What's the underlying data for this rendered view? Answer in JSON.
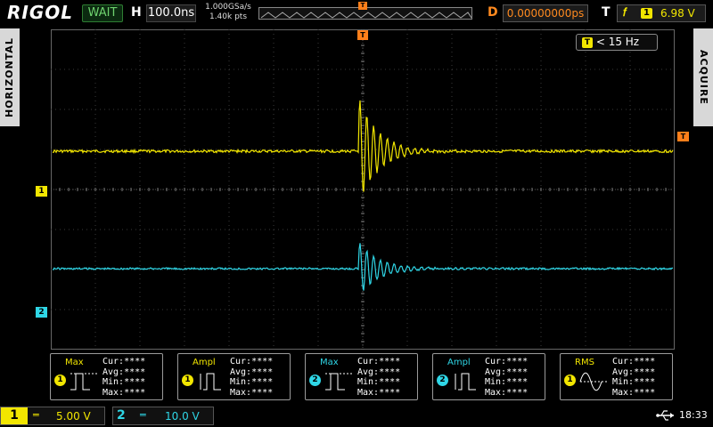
{
  "topbar": {
    "brand": "RIGOL",
    "run_status": "WAIT",
    "h_label": "H",
    "timebase": "100.0ns",
    "sample_rate": "1.000GSa/s",
    "memory_depth": "1.40k pts",
    "d_label": "D",
    "delay": "0.00000000ps",
    "t_label": "T",
    "trigger_source": "1",
    "trigger_level": "6.98 V",
    "trigger_marker": "T"
  },
  "side_tabs": {
    "left": "HORIZONTAL",
    "right": "ACQUIRE"
  },
  "frequency_counter": {
    "badge": "T",
    "value": "< 15 Hz"
  },
  "channel_markers": {
    "ch1": "1",
    "ch2": "2",
    "trigger": "T"
  },
  "colors": {
    "ch1": "#f2e600",
    "ch2": "#2fd6e6",
    "trigger": "#ff7f1a",
    "grid": "#3a3a3a",
    "status_green": "#6fd36f"
  },
  "measurements": [
    {
      "name": "Max",
      "channel": "1",
      "cur": "Cur:****",
      "avg": "Avg:****",
      "min": "Min:****",
      "max": "Max:****"
    },
    {
      "name": "Ampl",
      "channel": "1",
      "cur": "Cur:****",
      "avg": "Avg:****",
      "min": "Min:****",
      "max": "Max:****"
    },
    {
      "name": "Max",
      "channel": "2",
      "cur": "Cur:****",
      "avg": "Avg:****",
      "min": "Min:****",
      "max": "Max:****"
    },
    {
      "name": "Ampl",
      "channel": "2",
      "cur": "Cur:****",
      "avg": "Avg:****",
      "min": "Min:****",
      "max": "Max:****"
    },
    {
      "name": "RMS",
      "channel": "1",
      "cur": "Cur:****",
      "avg": "Avg:****",
      "min": "Min:****",
      "max": "Max:****"
    }
  ],
  "bottombar": {
    "ch1_num": "1",
    "ch1_scale": "5.00 V",
    "ch2_num": "2",
    "ch2_scale": "10.0 V",
    "time": "18:33"
  }
}
